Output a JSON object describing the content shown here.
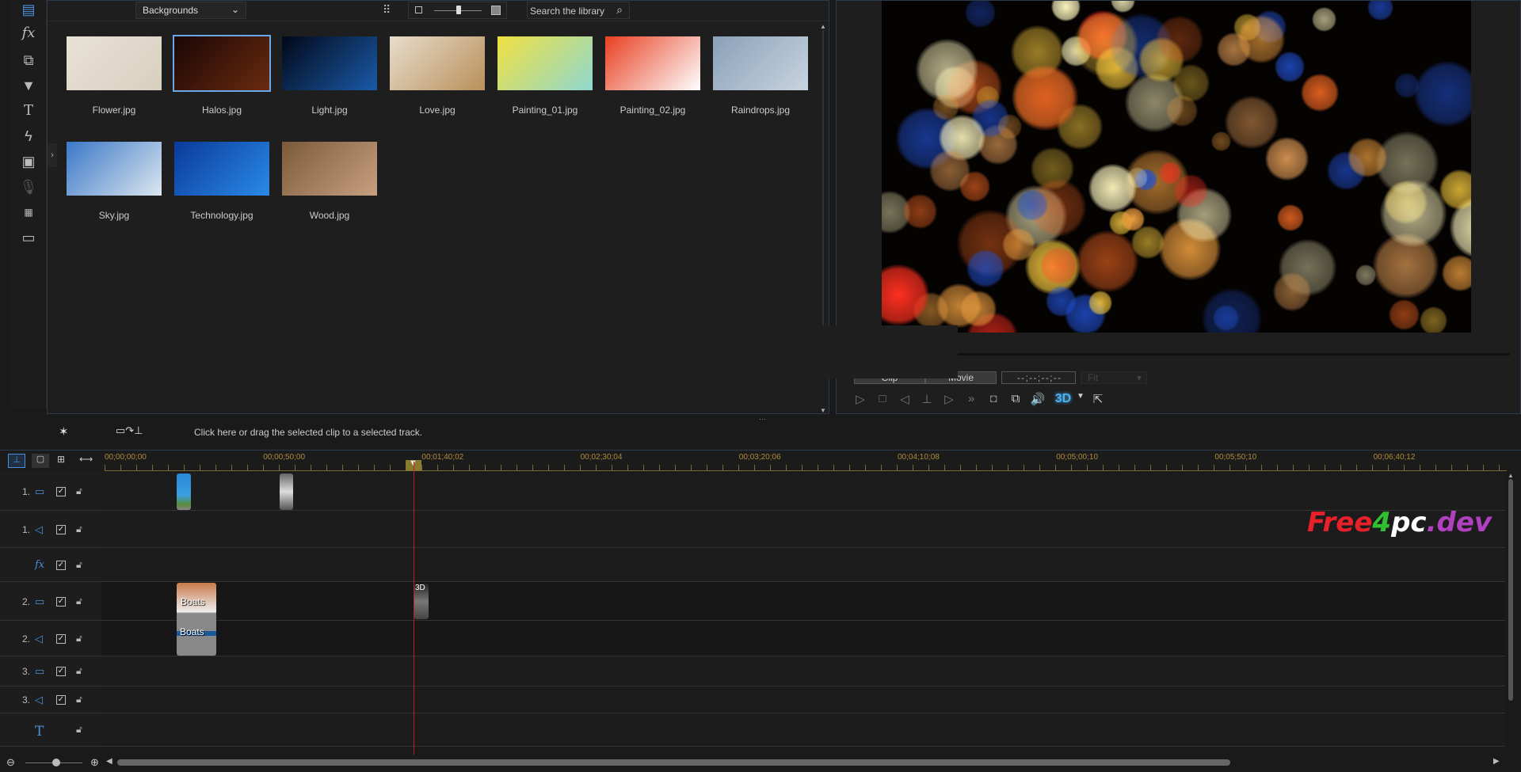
{
  "library": {
    "category": "Backgrounds",
    "search_placeholder": "Search the library",
    "items": [
      {
        "label": "Flower.jpg",
        "colors": [
          "#e8e2d6",
          "#d8cfbf"
        ]
      },
      {
        "label": "Halos.jpg",
        "colors": [
          "#1a0604",
          "#6a2a10"
        ],
        "selected": true
      },
      {
        "label": "Light.jpg",
        "colors": [
          "#020818",
          "#1a5aa8"
        ]
      },
      {
        "label": "Love.jpg",
        "colors": [
          "#e8dccc",
          "#b8905a"
        ]
      },
      {
        "label": "Painting_01.jpg",
        "colors": [
          "#f0e040",
          "#90d8d0"
        ]
      },
      {
        "label": "Painting_02.jpg",
        "colors": [
          "#e84020",
          "#ffffff"
        ]
      },
      {
        "label": "Raindrops.jpg",
        "colors": [
          "#8aa0b8",
          "#c8d4e0"
        ]
      },
      {
        "label": "Sky.jpg",
        "colors": [
          "#3a78c8",
          "#dce6f0"
        ]
      },
      {
        "label": "Technology.jpg",
        "colors": [
          "#0a3a9a",
          "#2a8ae8"
        ]
      },
      {
        "label": "Wood.jpg",
        "colors": [
          "#7a5a3a",
          "#c8a080"
        ]
      }
    ]
  },
  "preview": {
    "clip_label": "Clip",
    "movie_label": "Movie",
    "timecode": "- - ; - - ; - - ; - -",
    "fit_label": "Fit",
    "3d_label": "3D"
  },
  "toolbar": {
    "hint": "Click here or drag the selected clip to a selected track."
  },
  "ruler": {
    "labels": [
      "00;00;00;00",
      "00;00;50;00",
      "00;01;40;02",
      "00;02;30;04",
      "00;03;20;06",
      "00;04;10;08",
      "00;05;00;10",
      "00;05;50;10",
      "00;06;40;12"
    ]
  },
  "tracks": [
    {
      "num": "1.",
      "type": "video",
      "icon": "video-track-icon"
    },
    {
      "num": "1.",
      "type": "audio",
      "icon": "audio-track-icon"
    },
    {
      "num": "",
      "type": "fx",
      "icon": "fx-icon"
    },
    {
      "num": "2.",
      "type": "video",
      "icon": "video-track-icon"
    },
    {
      "num": "2.",
      "type": "audio",
      "icon": "audio-track-icon"
    },
    {
      "num": "3.",
      "type": "video",
      "icon": "video-track-icon"
    },
    {
      "num": "3.",
      "type": "audio",
      "icon": "audio-track-icon"
    },
    {
      "num": "",
      "type": "title",
      "icon": "title-icon"
    }
  ],
  "clips": {
    "boats_video": "Boats",
    "boats_audio": "Boats",
    "clip_3d": "3D"
  },
  "watermark": {
    "parts": [
      "Free",
      "4",
      "pc",
      ".dev"
    ],
    "colors": [
      "#e8202a",
      "#30c030",
      "#ffffff",
      "#b040c0"
    ]
  },
  "colors": {
    "accent": "#4a90d9",
    "playhead": "#c02020",
    "ruler_text": "#b08a3a"
  }
}
